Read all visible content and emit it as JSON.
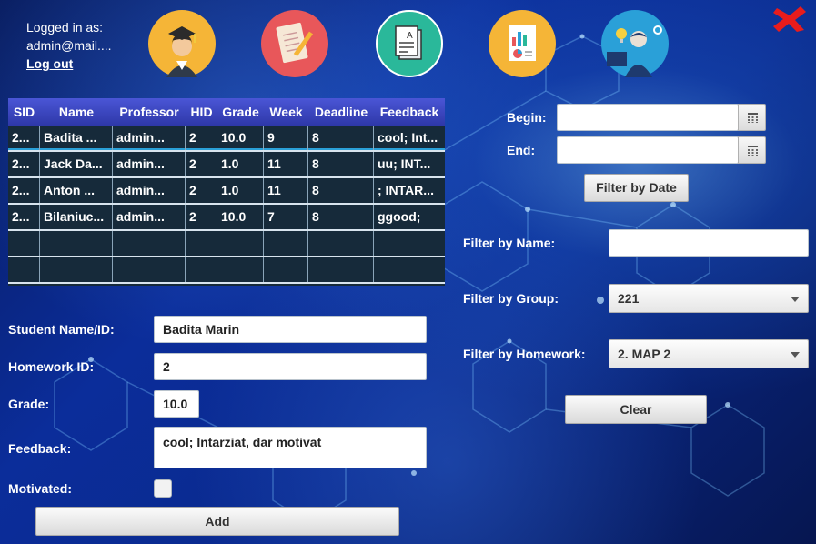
{
  "header": {
    "logged_in_label": "Logged in as:",
    "user_email": "admin@mail....",
    "logout_label": "Log out"
  },
  "nav_icons": [
    {
      "name": "students-icon",
      "color": "#f5b537"
    },
    {
      "name": "homework-icon",
      "color": "#e8575a"
    },
    {
      "name": "grades-document-icon",
      "color": "#2ab89a"
    },
    {
      "name": "reports-icon",
      "color": "#f5b537"
    },
    {
      "name": "professor-idea-icon",
      "color": "#2aa0d8"
    }
  ],
  "table": {
    "columns": [
      "SID",
      "Name",
      "Professor",
      "HID",
      "Grade",
      "Week",
      "Deadline",
      "Feedback"
    ],
    "rows": [
      [
        "2...",
        "Badita ...",
        "admin...",
        "2",
        "10.0",
        "9",
        "8",
        "cool; Int..."
      ],
      [
        "2...",
        "Jack Da...",
        "admin...",
        "2",
        "1.0",
        "11",
        "8",
        "uu; INT..."
      ],
      [
        "2...",
        "Anton ...",
        "admin...",
        "2",
        "1.0",
        "11",
        "8",
        "; INTAR..."
      ],
      [
        "2...",
        "Bilaniuc...",
        "admin...",
        "2",
        "10.0",
        "7",
        "8",
        "ggood;"
      ],
      [
        "",
        "",
        "",
        "",
        "",
        "",
        "",
        ""
      ],
      [
        "",
        "",
        "",
        "",
        "",
        "",
        "",
        ""
      ]
    ]
  },
  "form": {
    "student_label": "Student Name/ID:",
    "student_value": "Badita Marin",
    "homework_label": "Homework ID:",
    "homework_value": "2",
    "grade_label": "Grade:",
    "grade_value": "10.0",
    "feedback_label": "Feedback:",
    "feedback_value": "cool; Intarziat, dar motivat",
    "motivated_label": "Motivated:",
    "motivated_checked": false,
    "add_label": "Add"
  },
  "filters": {
    "begin_label": "Begin:",
    "begin_value": "",
    "end_label": "End:",
    "end_value": "",
    "filter_date_label": "Filter by Date",
    "name_label": "Filter by Name:",
    "name_value": "",
    "group_label": "Filter by Group:",
    "group_value": "221",
    "homework_label": "Filter by Homework:",
    "homework_value": "2. MAP 2",
    "clear_label": "Clear"
  },
  "colors": {
    "close_x": "#e81c1c",
    "table_header": "#3a44c0",
    "table_body": "#162a3a"
  }
}
